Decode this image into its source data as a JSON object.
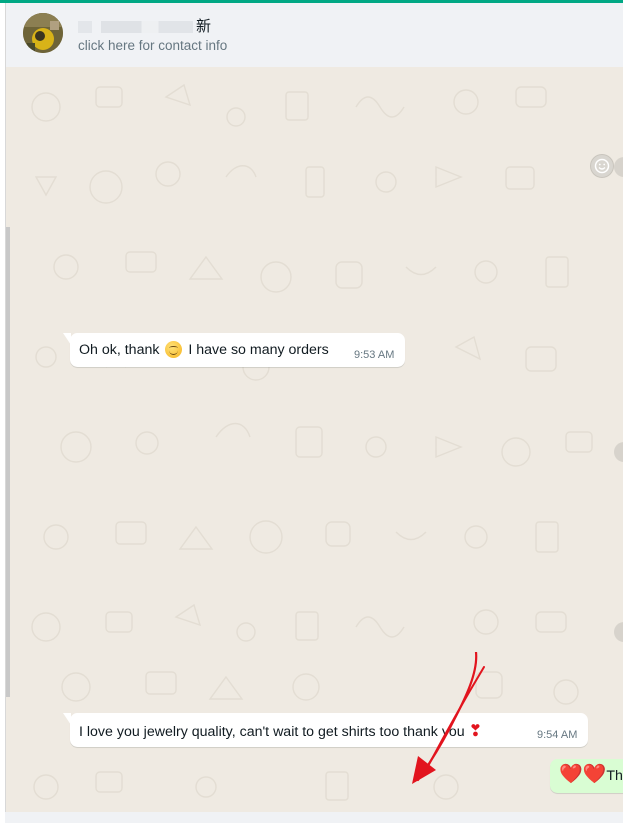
{
  "header": {
    "name_suffix": "新",
    "subtitle": "click here for contact info"
  },
  "messages": [
    {
      "text_before": "Oh ok, thank",
      "text_after": "I have so many orders",
      "time": "9:53 AM",
      "emoji": "smiling-face"
    },
    {
      "text": "I love you jewelry quality, can't wait to get shirts too thank you",
      "time": "9:54 AM",
      "emoji": "red-exclamation"
    },
    {
      "text": "Tha",
      "emoji": "two-red-hearts",
      "direction": "outgoing"
    }
  ],
  "emoji_glyphs": {
    "exclamation": "❣",
    "hearts": "❤️❤️"
  },
  "colors": {
    "accent": "#00a884",
    "chat_background": "#efeae2",
    "incoming_bubble": "#ffffff",
    "outgoing_bubble": "#d9fdd3",
    "annotation_arrow": "#e2141e"
  }
}
